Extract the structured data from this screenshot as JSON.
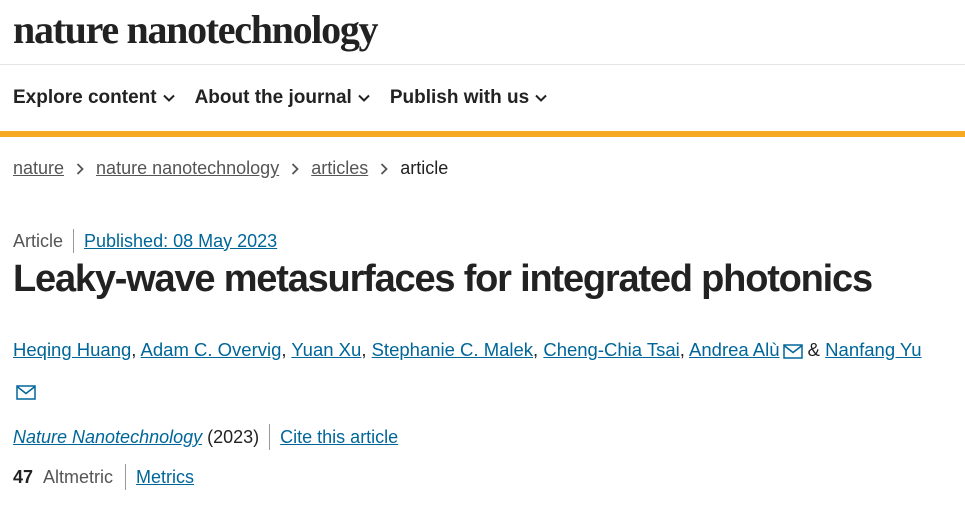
{
  "site": {
    "logo": "nature nanotechnology"
  },
  "nav": [
    {
      "label": "Explore content"
    },
    {
      "label": "About the journal"
    },
    {
      "label": "Publish with us"
    }
  ],
  "breadcrumb": [
    "nature",
    "nature nanotechnology",
    "articles",
    "article"
  ],
  "article": {
    "type": "Article",
    "published": "Published: 08 May 2023",
    "title": "Leaky-wave metasurfaces for integrated photonics",
    "authors": [
      {
        "name": "Heqing Huang",
        "sep": ", "
      },
      {
        "name": "Adam C. Overvig",
        "sep": ", "
      },
      {
        "name": "Yuan Xu",
        "sep": ", "
      },
      {
        "name": "Stephanie C. Malek",
        "sep": ", "
      },
      {
        "name": "Cheng-Chia Tsai",
        "sep": ", "
      },
      {
        "name": "Andrea Alù",
        "sep": " & "
      },
      {
        "name": "Nanfang Yu",
        "sep": ""
      }
    ],
    "journal": "Nature Nanotechnology",
    "year": "(2023)",
    "cite_label": "Cite this article",
    "altmetric_score": "47",
    "altmetric_label": "Altmetric",
    "metrics_label": "Metrics"
  },
  "colors": {
    "accent": "#f7a823",
    "link": "#006699",
    "text": "#222222"
  }
}
